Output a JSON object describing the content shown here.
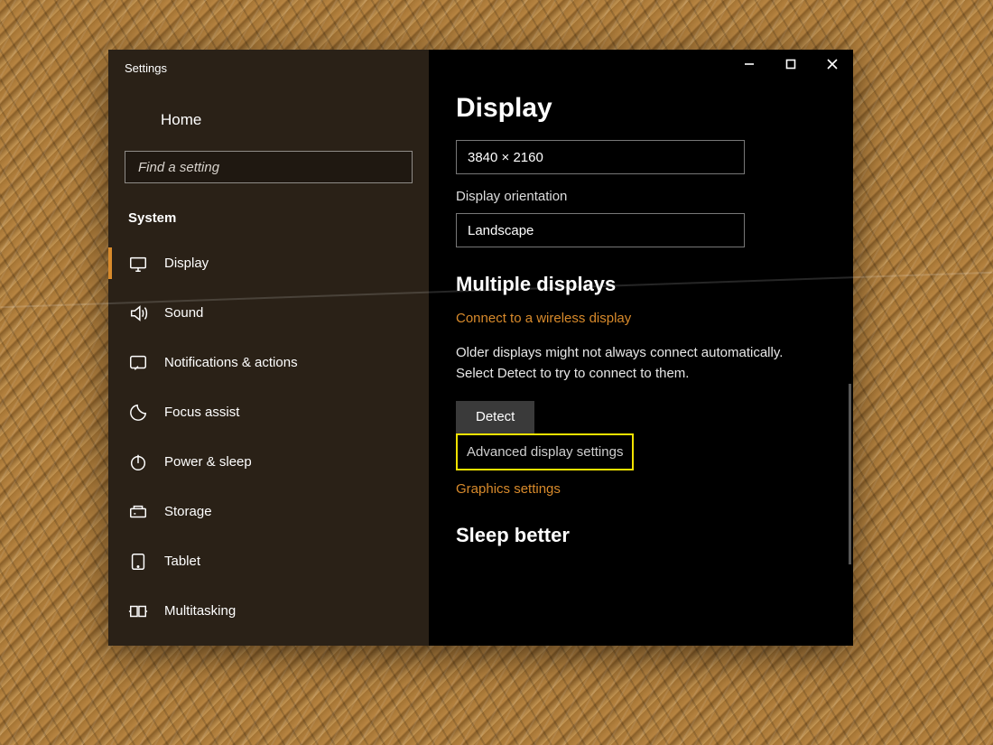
{
  "window": {
    "title": "Settings"
  },
  "sidebar": {
    "home": "Home",
    "search_placeholder": "Find a setting",
    "category": "System",
    "items": [
      {
        "label": "Display",
        "icon": "monitor-icon",
        "selected": true
      },
      {
        "label": "Sound",
        "icon": "speaker-icon",
        "selected": false
      },
      {
        "label": "Notifications & actions",
        "icon": "notifications-icon",
        "selected": false
      },
      {
        "label": "Focus assist",
        "icon": "moon-icon",
        "selected": false
      },
      {
        "label": "Power & sleep",
        "icon": "power-icon",
        "selected": false
      },
      {
        "label": "Storage",
        "icon": "storage-icon",
        "selected": false
      },
      {
        "label": "Tablet",
        "icon": "tablet-icon",
        "selected": false
      },
      {
        "label": "Multitasking",
        "icon": "multitasking-icon",
        "selected": false
      }
    ]
  },
  "main": {
    "heading": "Display",
    "resolution_dropdown": "3840 × 2160",
    "orientation_label": "Display orientation",
    "orientation_dropdown": "Landscape",
    "multiple_heading": "Multiple displays",
    "wireless_link": "Connect to a wireless display",
    "detect_text": "Older displays might not always connect automatically. Select Detect to try to connect to them.",
    "detect_button": "Detect",
    "advanced_link": "Advanced display settings",
    "graphics_link": "Graphics settings",
    "sleep_heading": "Sleep better"
  },
  "colors": {
    "accent": "#d88a2b",
    "highlight": "#f2e200"
  }
}
